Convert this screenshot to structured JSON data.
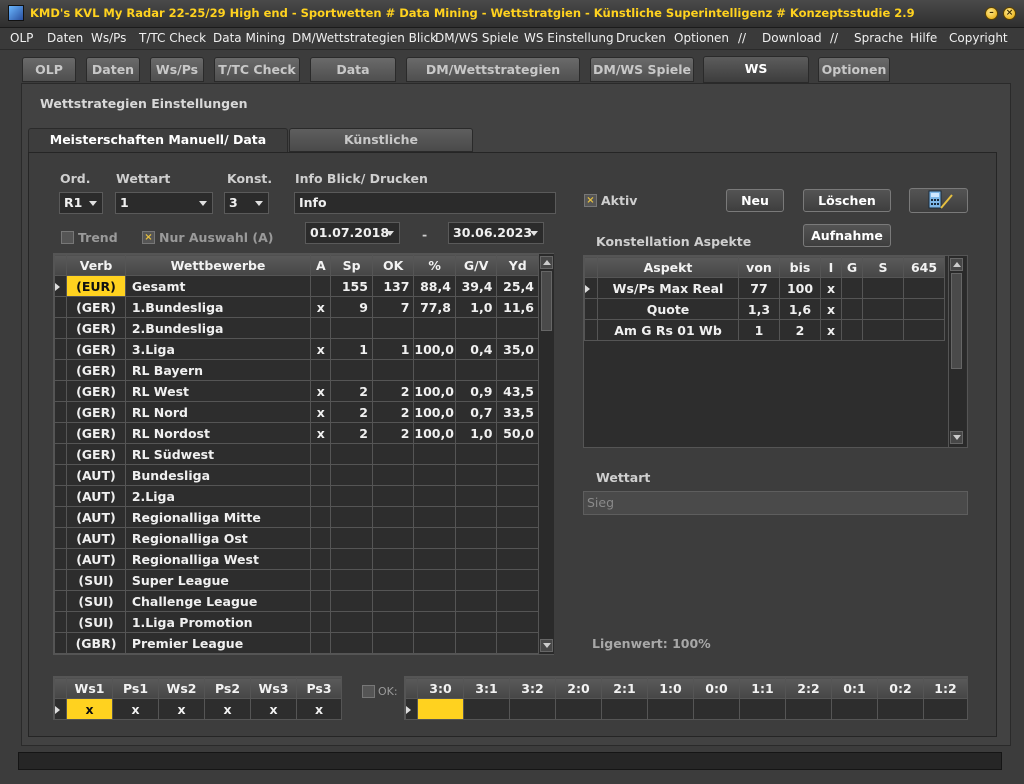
{
  "title": "KMD's KVL My Radar 22-25/29 High end - Sportwetten # Data Mining - Wettstratgien - Künstliche Superintelligenz # Konzeptsstudie 2.9",
  "window_buttons": [
    "minimize",
    "close"
  ],
  "menu": [
    "OLP",
    "Daten",
    "Ws/Ps",
    "T/TC Check",
    "Data Mining",
    "DM/Wettstrategien Blick",
    "DM/WS Spiele",
    "WS Einstellung",
    "Drucken",
    "Optionen",
    "//",
    "Download",
    "//",
    "Sprache",
    "Hilfe",
    "Copyright"
  ],
  "tabs": [
    "OLP",
    "Daten",
    "Ws/Ps",
    "T/TC Check",
    "Data Mining",
    "DM/Wettstrategien Blick",
    "DM/WS Spiele",
    "WS Einstellung",
    "Optionen"
  ],
  "active_tab": "WS Einstellung",
  "section_title": "Wettstrategien Einstellungen",
  "subtabs": [
    "Meisterschaften Manuell/ Data Mining",
    "Künstliche Superintelligenz"
  ],
  "filters": {
    "ord_label": "Ord.",
    "ord_value": "R1",
    "wettart_label": "Wettart",
    "wettart_value": "1",
    "konst_label": "Konst.",
    "konst_value": "3",
    "info_label": "Info Blick/ Drucken",
    "info_value": "Info",
    "trend_label": "Trend",
    "trend_checked": false,
    "nur_auswahl_label": "Nur Auswahl (A)",
    "nur_auswahl_checked": true,
    "date_from": "01.07.2018",
    "date_sep": "-",
    "date_to": "30.06.2023"
  },
  "aktiv": {
    "label": "Aktiv",
    "checked": true
  },
  "buttons": {
    "neu": "Neu",
    "loeschen": "Löschen",
    "aufnahme": "Aufnahme",
    "icon_button": "calculator-pen-icon"
  },
  "competitions": {
    "columns": [
      "Verb",
      "Wettbewerbe",
      "A",
      "Sp",
      "OK",
      "%",
      "G/V",
      "Yd"
    ],
    "rows": [
      {
        "verb": "(EUR)",
        "name": "Gesamt",
        "a": "",
        "sp": "155",
        "ok": "137",
        "pct": "88,4",
        "gv": "39,4",
        "yd": "25,4",
        "current": true
      },
      {
        "verb": "(GER)",
        "name": "1.Bundesliga",
        "a": "x",
        "sp": "9",
        "ok": "7",
        "pct": "77,8",
        "gv": "1,0",
        "yd": "11,6"
      },
      {
        "verb": "(GER)",
        "name": "2.Bundesliga",
        "a": "",
        "sp": "",
        "ok": "",
        "pct": "",
        "gv": "",
        "yd": ""
      },
      {
        "verb": "(GER)",
        "name": "3.Liga",
        "a": "x",
        "sp": "1",
        "ok": "1",
        "pct": "100,0",
        "gv": "0,4",
        "yd": "35,0"
      },
      {
        "verb": "(GER)",
        "name": "RL Bayern",
        "a": "",
        "sp": "",
        "ok": "",
        "pct": "",
        "gv": "",
        "yd": ""
      },
      {
        "verb": "(GER)",
        "name": "RL West",
        "a": "x",
        "sp": "2",
        "ok": "2",
        "pct": "100,0",
        "gv": "0,9",
        "yd": "43,5"
      },
      {
        "verb": "(GER)",
        "name": "RL Nord",
        "a": "x",
        "sp": "2",
        "ok": "2",
        "pct": "100,0",
        "gv": "0,7",
        "yd": "33,5"
      },
      {
        "verb": "(GER)",
        "name": "RL Nordost",
        "a": "x",
        "sp": "2",
        "ok": "2",
        "pct": "100,0",
        "gv": "1,0",
        "yd": "50,0"
      },
      {
        "verb": "(GER)",
        "name": "RL Südwest",
        "a": "",
        "sp": "",
        "ok": "",
        "pct": "",
        "gv": "",
        "yd": ""
      },
      {
        "verb": "(AUT)",
        "name": "Bundesliga",
        "a": "",
        "sp": "",
        "ok": "",
        "pct": "",
        "gv": "",
        "yd": ""
      },
      {
        "verb": "(AUT)",
        "name": "2.Liga",
        "a": "",
        "sp": "",
        "ok": "",
        "pct": "",
        "gv": "",
        "yd": ""
      },
      {
        "verb": "(AUT)",
        "name": "Regionalliga Mitte",
        "a": "",
        "sp": "",
        "ok": "",
        "pct": "",
        "gv": "",
        "yd": ""
      },
      {
        "verb": "(AUT)",
        "name": "Regionalliga Ost",
        "a": "",
        "sp": "",
        "ok": "",
        "pct": "",
        "gv": "",
        "yd": ""
      },
      {
        "verb": "(AUT)",
        "name": "Regionalliga West",
        "a": "",
        "sp": "",
        "ok": "",
        "pct": "",
        "gv": "",
        "yd": ""
      },
      {
        "verb": "(SUI)",
        "name": "Super League",
        "a": "",
        "sp": "",
        "ok": "",
        "pct": "",
        "gv": "",
        "yd": ""
      },
      {
        "verb": "(SUI)",
        "name": "Challenge League",
        "a": "",
        "sp": "",
        "ok": "",
        "pct": "",
        "gv": "",
        "yd": ""
      },
      {
        "verb": "(SUI)",
        "name": "1.Liga Promotion",
        "a": "",
        "sp": "",
        "ok": "",
        "pct": "",
        "gv": "",
        "yd": ""
      },
      {
        "verb": "(GBR)",
        "name": "Premier League",
        "a": "",
        "sp": "",
        "ok": "",
        "pct": "",
        "gv": "",
        "yd": ""
      }
    ]
  },
  "konstellation": {
    "title": "Konstellation Aspekte",
    "columns": [
      "Aspekt",
      "von",
      "bis",
      "I",
      "G",
      "S",
      "645"
    ],
    "rows": [
      {
        "aspekt": "Ws/Ps Max Real",
        "von": "77",
        "bis": "100",
        "i": "x",
        "g": "",
        "s": "",
        "n": "",
        "current": true
      },
      {
        "aspekt": "Quote",
        "von": "1,3",
        "bis": "1,6",
        "i": "x",
        "g": "",
        "s": "",
        "n": ""
      },
      {
        "aspekt": "Am G Rs 01 Wb",
        "von": "1",
        "bis": "2",
        "i": "x",
        "g": "",
        "s": "",
        "n": ""
      }
    ]
  },
  "wettart_section": {
    "label": "Wettart",
    "value": "Sieg"
  },
  "ligenwert": "Ligenwert: 100%",
  "ws_ps": {
    "columns": [
      "Ws1",
      "Ps1",
      "Ws2",
      "Ps2",
      "Ws3",
      "Ps3"
    ],
    "values": [
      "x",
      "x",
      "x",
      "x",
      "x",
      "x"
    ]
  },
  "ok_filter": {
    "label": "OK:",
    "checked": false
  },
  "scores": {
    "columns": [
      "3:0",
      "3:1",
      "3:2",
      "2:0",
      "2:1",
      "1:0",
      "0:0",
      "1:1",
      "2:2",
      "0:1",
      "0:2",
      "1:2"
    ],
    "values": [
      "",
      "",
      "",
      "",
      "",
      "",
      "",
      "",
      "",
      "",
      "",
      ""
    ]
  },
  "colors": {
    "accent": "#ffd21f",
    "background": "#3c3c3c",
    "grid": "#2d2d2d"
  }
}
